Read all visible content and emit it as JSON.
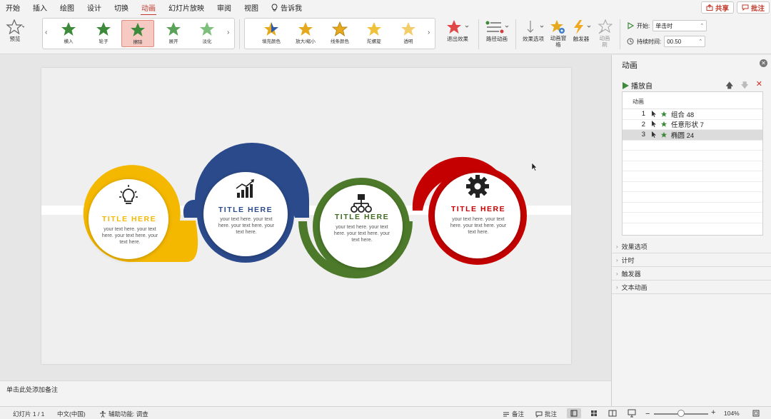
{
  "menu": {
    "items": [
      "开始",
      "插入",
      "绘图",
      "设计",
      "切换",
      "动画",
      "幻灯片放映",
      "审阅",
      "视图"
    ],
    "active": "动画",
    "tell_me": "告诉我",
    "share": "共享",
    "comment": "批注"
  },
  "ribbon": {
    "preview": "预览",
    "entrance_effects": [
      "横入",
      "轮子",
      "擦除",
      "展开",
      "淡化"
    ],
    "selected_effect": "擦除",
    "emphasis_effects": [
      "填充颜色",
      "放大/缩小",
      "线条颜色",
      "陀螺旋",
      "透明"
    ],
    "exit_effects": "退出效果",
    "motion_paths": "路径动画",
    "effect_options": "效果选项",
    "animation_pane": "动画窗格",
    "trigger": "触发器",
    "animation_painter": "动画刷",
    "start_label": "开始:",
    "start_value": "单击时",
    "duration_label": "持续时间:",
    "duration_value": "00.50"
  },
  "slide": {
    "steps": [
      {
        "title": "TITLE HERE",
        "body": "your text here. your text here. your text here. your text here.",
        "color": "#F5B800",
        "icon": "lightbulb-icon"
      },
      {
        "title": "TITLE HERE",
        "body": "your text here. your text here. your text here. your text here.",
        "color": "#2B4A8B",
        "icon": "rising-chart-icon"
      },
      {
        "title": "TITLE HERE",
        "body": "your text here. your text here. your text here. your text here.",
        "color": "#4C7A2A",
        "icon": "hierarchy-icon"
      },
      {
        "title": "TITLE HERE",
        "body": "your text here. your text here. your text here. your text here.",
        "color": "#C40000",
        "icon": "gear-icon"
      }
    ]
  },
  "notes": {
    "placeholder": "单击此处添加备注"
  },
  "pane": {
    "title": "动画",
    "play_from": "播放自",
    "list_header": "动画",
    "items": [
      {
        "num": "1",
        "name": "组合 48"
      },
      {
        "num": "2",
        "name": "任意形状 7"
      },
      {
        "num": "3",
        "name": "椭圆 24"
      }
    ],
    "sections": [
      "效果选项",
      "计时",
      "触发器",
      "文本动画"
    ]
  },
  "status": {
    "slide": "幻灯片 1 / 1",
    "language": "中文(中国)",
    "accessibility": "辅助功能: 调查",
    "notes": "备注",
    "comments": "批注",
    "zoom": "104%"
  }
}
